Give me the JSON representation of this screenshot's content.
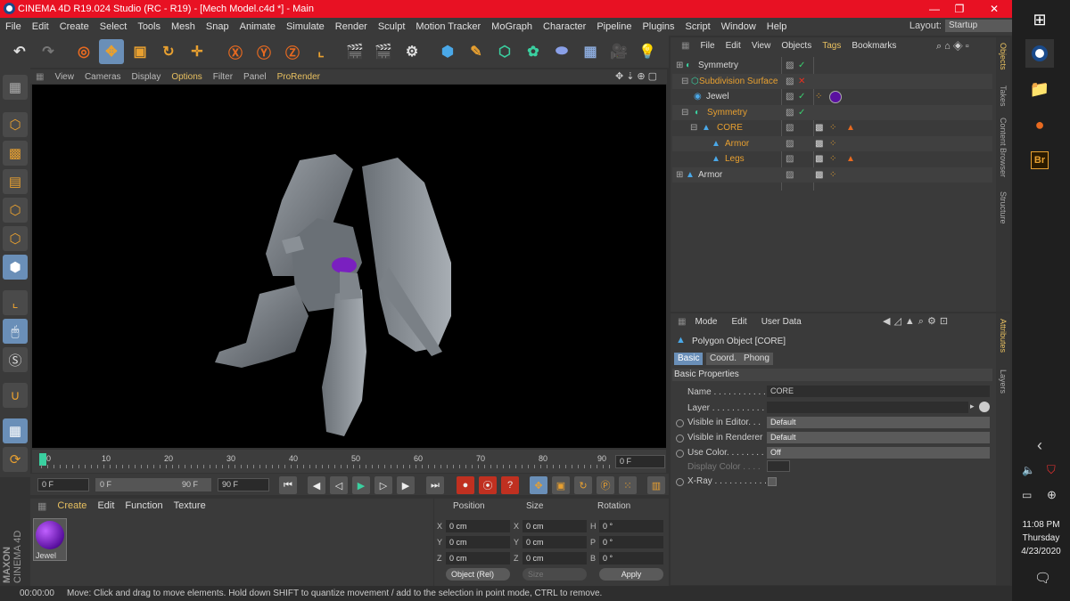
{
  "window": {
    "title": "CINEMA 4D R19.024 Studio (RC - R19) - [Mech Model.c4d *] - Main",
    "minimize": "—",
    "maximize": "❐",
    "close": "✕"
  },
  "menu": [
    "File",
    "Edit",
    "Create",
    "Select",
    "Tools",
    "Mesh",
    "Snap",
    "Animate",
    "Simulate",
    "Render",
    "Sculpt",
    "Motion Tracker",
    "MoGraph",
    "Character",
    "Pipeline",
    "Plugins",
    "Script",
    "Window",
    "Help"
  ],
  "layout": {
    "label": "Layout:",
    "value": "Startup"
  },
  "viewport_menu": [
    "View",
    "Cameras",
    "Display",
    "Options",
    "Filter",
    "Panel",
    "ProRender"
  ],
  "timeline": {
    "ticks": [
      "0",
      "10",
      "20",
      "30",
      "40",
      "50",
      "60",
      "70",
      "80",
      "90"
    ],
    "current_frame": "0 F"
  },
  "transport": {
    "start": "0 F",
    "range_start": "0 F",
    "range_end": "90 F",
    "end": "90 F"
  },
  "material_manager": {
    "menu": [
      "Create",
      "Edit",
      "Function",
      "Texture"
    ],
    "material_name": "Jewel"
  },
  "coordinates": {
    "headers": [
      "Position",
      "Size",
      "Rotation"
    ],
    "rows": [
      {
        "axis": "X",
        "pos": "0 cm",
        "size_axis": "X",
        "size": "0 cm",
        "rot_axis": "H",
        "rot": "0 °"
      },
      {
        "axis": "Y",
        "pos": "0 cm",
        "size_axis": "Y",
        "size": "0 cm",
        "rot_axis": "P",
        "rot": "0 °"
      },
      {
        "axis": "Z",
        "pos": "0 cm",
        "size_axis": "Z",
        "size": "0 cm",
        "rot_axis": "B",
        "rot": "0 °"
      }
    ],
    "mode": "Object (Rel)",
    "size_mode": "Size",
    "apply": "Apply"
  },
  "status": {
    "time": "00:00:00",
    "message": "Move: Click and drag to move elements. Hold down SHIFT to quantize movement / add to the selection in point mode, CTRL to remove."
  },
  "object_manager": {
    "menu": [
      "File",
      "Edit",
      "View",
      "Objects",
      "Tags",
      "Bookmarks"
    ],
    "objects": [
      {
        "name": "Symmetry",
        "color": "#d8d8d8"
      },
      {
        "name": "Subdivision Surface",
        "color": "#e8a030"
      },
      {
        "name": "Jewel",
        "color": "#d8d8d8"
      },
      {
        "name": "Symmetry",
        "color": "#e8a030"
      },
      {
        "name": "CORE",
        "color": "#e8a030"
      },
      {
        "name": "Armor",
        "color": "#e8a030"
      },
      {
        "name": "Legs",
        "color": "#e8a030"
      },
      {
        "name": "Armor",
        "color": "#d8d8d8"
      }
    ]
  },
  "side_tabs_top": [
    "Objects",
    "Takes",
    "Content Browser",
    "Structure"
  ],
  "side_tabs_bottom": [
    "Attributes",
    "Layers"
  ],
  "attributes": {
    "menu": [
      "Mode",
      "Edit",
      "User Data"
    ],
    "header": "Polygon Object [CORE]",
    "tabs": [
      "Basic",
      "Coord.",
      "Phong"
    ],
    "section": "Basic Properties",
    "props": [
      {
        "label": "Name . . . . . . . . . . . .",
        "value": "CORE"
      },
      {
        "label": "Layer . . . . . . . . . . . .",
        "value": ""
      },
      {
        "label": "Visible in Editor. . .",
        "value": "Default"
      },
      {
        "label": "Visible in Renderer",
        "value": "Default"
      },
      {
        "label": "Use Color. . . . . . . . .",
        "value": "Off"
      },
      {
        "label": "Display Color . . . .",
        "value": ""
      },
      {
        "label": "X-Ray . . . . . . . . . . .",
        "value": ""
      }
    ]
  },
  "taskbar": {
    "time": "11:08 PM",
    "day": "Thursday",
    "date": "4/23/2020",
    "br": "Br"
  },
  "brand": {
    "maxon": "MAXON",
    "product": "CINEMA 4D"
  }
}
